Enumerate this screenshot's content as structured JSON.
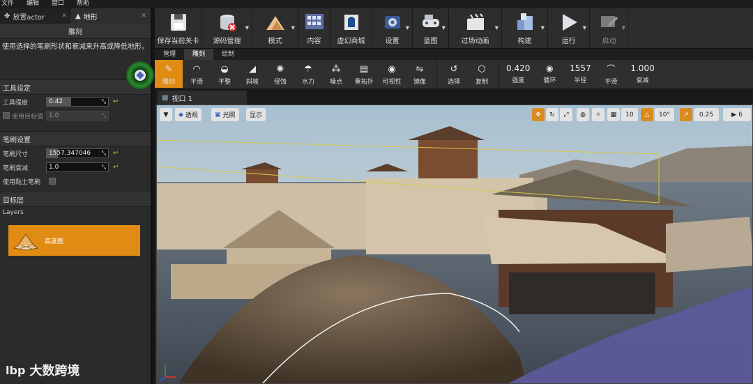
{
  "menu": [
    "文件",
    "编辑",
    "窗口",
    "帮助"
  ],
  "tabs": {
    "place_actor": "放置actor",
    "landscape": "地形"
  },
  "subtab": "雕刻",
  "description": "使用选择的笔刷形状和衰减来升高或降低地形。",
  "tool_settings": {
    "title": "工具设定",
    "strength_label": "工具强度",
    "strength_value": "0.42",
    "use_target_label": "使用目标值",
    "use_target_value": "1.0"
  },
  "brush_settings": {
    "title": "笔刷设置",
    "size_label": "笔刷尺寸",
    "size_value": "1557.347046",
    "falloff_label": "笔刷衰减",
    "falloff_value": "1.0",
    "clay_label": "使用黏土笔刷"
  },
  "target_layer": {
    "title": "目标层",
    "layers_label": "Layers",
    "heightmap": "高度图"
  },
  "watermark": {
    "logo": "lbp",
    "text": "大数跨境"
  },
  "toolbar": [
    {
      "label": "保存当前关卡",
      "icon": "save-icon"
    },
    {
      "label": "源码管理",
      "icon": "source-control-icon"
    },
    {
      "label": "模式",
      "icon": "modes-icon"
    },
    {
      "label": "内容",
      "icon": "content-icon"
    },
    {
      "label": "虚幻商城",
      "icon": "marketplace-icon"
    },
    {
      "label": "设置",
      "icon": "settings-icon"
    },
    {
      "label": "蓝图",
      "icon": "blueprint-icon"
    },
    {
      "label": "过场动画",
      "icon": "cinematics-icon"
    },
    {
      "label": "构建",
      "icon": "build-icon"
    },
    {
      "label": "运行",
      "icon": "play-icon"
    },
    {
      "label": "启动",
      "icon": "launch-icon"
    }
  ],
  "mode_tabs": [
    "管理",
    "雕刻",
    "绘制"
  ],
  "tools": [
    {
      "label": "雕刻",
      "glyph": "✎"
    },
    {
      "label": "平滑",
      "glyph": "◠"
    },
    {
      "label": "平整",
      "glyph": "◒"
    },
    {
      "label": "斜坡",
      "glyph": "◢"
    },
    {
      "label": "侵蚀",
      "glyph": "✺"
    },
    {
      "label": "水力",
      "glyph": "☂"
    },
    {
      "label": "噪点",
      "glyph": "⁂"
    },
    {
      "label": "重拓扑",
      "glyph": "▤"
    },
    {
      "label": "可视性",
      "glyph": "◉"
    },
    {
      "label": "镜像",
      "glyph": "⇋"
    }
  ],
  "tools2": [
    {
      "label": "选择",
      "glyph": "↺"
    },
    {
      "label": "复制",
      "glyph": "⬡"
    }
  ],
  "stats": [
    {
      "value": "0.420",
      "label": "强度"
    },
    {
      "value": "",
      "label": "循环"
    },
    {
      "value": "1557",
      "label": "半径"
    },
    {
      "value": "",
      "label": "平滑"
    },
    {
      "value": "1.000",
      "label": "衰减"
    }
  ],
  "viewport": {
    "tab": "视口 1",
    "perspective": "透视",
    "lit": "光照",
    "show": "显示",
    "grid_value": "10",
    "angle_value": "10°",
    "scale_value": "0.25",
    "camera_speed": "6"
  }
}
